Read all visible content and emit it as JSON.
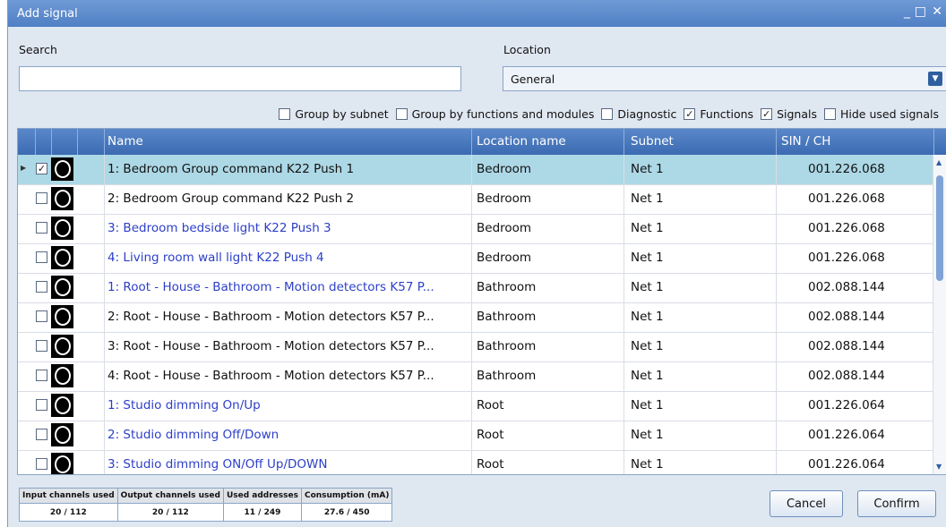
{
  "window": {
    "title": "Add signal"
  },
  "search": {
    "label": "Search",
    "value": ""
  },
  "location": {
    "label": "Location",
    "selected": "General"
  },
  "filters": [
    {
      "label": "Group by subnet",
      "checked": false
    },
    {
      "label": "Group by functions and modules",
      "checked": false
    },
    {
      "label": "Diagnostic",
      "checked": false
    },
    {
      "label": "Functions",
      "checked": true
    },
    {
      "label": "Signals",
      "checked": true
    },
    {
      "label": "Hide used signals",
      "checked": false
    }
  ],
  "columns": {
    "name": "Name",
    "location": "Location name",
    "subnet": "Subnet",
    "sin": "SIN / CH"
  },
  "rows": [
    {
      "name": "1: Bedroom Group command K22 Push 1",
      "location": "Bedroom",
      "subnet": "Net 1",
      "sin": "001.226.068",
      "checked": true,
      "selected": true,
      "blue": false
    },
    {
      "name": "2: Bedroom Group command K22 Push 2",
      "location": "Bedroom",
      "subnet": "Net 1",
      "sin": "001.226.068",
      "checked": false,
      "selected": false,
      "blue": false
    },
    {
      "name": "3: Bedroom bedside light K22 Push 3",
      "location": "Bedroom",
      "subnet": "Net 1",
      "sin": "001.226.068",
      "checked": false,
      "selected": false,
      "blue": true
    },
    {
      "name": "4: Living room wall light K22 Push 4",
      "location": "Bedroom",
      "subnet": "Net 1",
      "sin": "001.226.068",
      "checked": false,
      "selected": false,
      "blue": true
    },
    {
      "name": "1: Root - House - Bathroom - Motion detectors K57 P...",
      "location": "Bathroom",
      "subnet": "Net 1",
      "sin": "002.088.144",
      "checked": false,
      "selected": false,
      "blue": true
    },
    {
      "name": "2: Root - House - Bathroom - Motion detectors K57 P...",
      "location": "Bathroom",
      "subnet": "Net 1",
      "sin": "002.088.144",
      "checked": false,
      "selected": false,
      "blue": false
    },
    {
      "name": "3: Root - House - Bathroom - Motion detectors K57 P...",
      "location": "Bathroom",
      "subnet": "Net 1",
      "sin": "002.088.144",
      "checked": false,
      "selected": false,
      "blue": false
    },
    {
      "name": "4: Root - House - Bathroom - Motion detectors K57 P...",
      "location": "Bathroom",
      "subnet": "Net 1",
      "sin": "002.088.144",
      "checked": false,
      "selected": false,
      "blue": false
    },
    {
      "name": "1: Studio dimming On/Up",
      "location": "Root",
      "subnet": "Net 1",
      "sin": "001.226.064",
      "checked": false,
      "selected": false,
      "blue": true
    },
    {
      "name": "2: Studio dimming Off/Down",
      "location": "Root",
      "subnet": "Net 1",
      "sin": "001.226.064",
      "checked": false,
      "selected": false,
      "blue": true
    },
    {
      "name": "3: Studio dimming ON/Off Up/DOWN",
      "location": "Root",
      "subnet": "Net 1",
      "sin": "001.226.064",
      "checked": false,
      "selected": false,
      "blue": true
    }
  ],
  "stats": [
    {
      "label": "Input channels used",
      "value": "20 / 112"
    },
    {
      "label": "Output channels used",
      "value": "20 / 112"
    },
    {
      "label": "Used addresses",
      "value": "11 / 249"
    },
    {
      "label": "Consumption (mA)",
      "value": "27.6 / 450"
    }
  ],
  "buttons": {
    "cancel": "Cancel",
    "confirm": "Confirm"
  },
  "colors": {
    "titlebar": "#5b88cb",
    "header": "#4a78bd",
    "selected_row": "#add8e6",
    "link_text": "#2c3fc8"
  }
}
